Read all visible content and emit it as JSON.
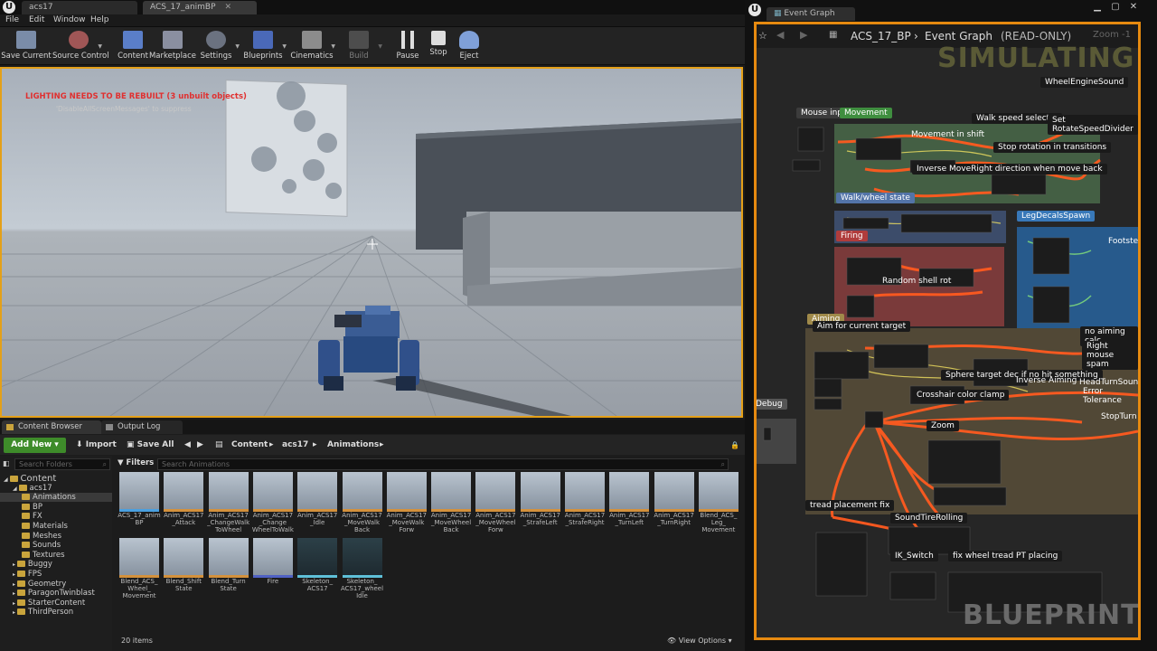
{
  "editor": {
    "tabs": [
      "acs17",
      "ACS_17_animBP"
    ],
    "menu": [
      "File",
      "Edit",
      "Window",
      "Help"
    ],
    "toolbar": {
      "save_current": "Save Current",
      "source_control": "Source Control",
      "content": "Content",
      "marketplace": "Marketplace",
      "settings": "Settings",
      "blueprints": "Blueprints",
      "cinematics": "Cinematics",
      "build": "Build",
      "pause": "Pause",
      "stop": "Stop",
      "eject": "Eject"
    },
    "viewport": {
      "warning": "LIGHTING NEEDS TO BE REBUILT (3 unbuilt objects)",
      "hint": "'DisableAllScreenMessages' to suppress"
    }
  },
  "content_browser": {
    "tabs": [
      "Content Browser",
      "Output Log"
    ],
    "add_new": "Add New",
    "import": "Import",
    "save_all": "Save All",
    "breadcrumb": [
      "Content",
      "acs17",
      "Animations"
    ],
    "search_folders": "Search Folders",
    "filters": "Filters",
    "search_animations": "Search Animations",
    "tree": [
      {
        "label": "Content",
        "level": 0
      },
      {
        "label": "acs17",
        "level": 1
      },
      {
        "label": "Animations",
        "level": 2,
        "selected": true
      },
      {
        "label": "BP",
        "level": 2
      },
      {
        "label": "FX",
        "level": 2
      },
      {
        "label": "Materials",
        "level": 2
      },
      {
        "label": "Meshes",
        "level": 2
      },
      {
        "label": "Sounds",
        "level": 2
      },
      {
        "label": "Textures",
        "level": 2
      },
      {
        "label": "Buggy",
        "level": 1
      },
      {
        "label": "FPS",
        "level": 1
      },
      {
        "label": "Geometry",
        "level": 1
      },
      {
        "label": "ParagonTwinblast",
        "level": 1
      },
      {
        "label": "StarterContent",
        "level": 1
      },
      {
        "label": "ThirdPerson",
        "level": 1
      }
    ],
    "assets": [
      "ACS_17_anim BP",
      "Anim_ACS17 _Attack",
      "Anim_ACS17 _ChangeWalk ToWheel",
      "Anim_ACS17 _Change WheelToWalk",
      "Anim_ACS17 _Idle",
      "Anim_ACS17 _MoveWalk Back",
      "Anim_ACS17 _MoveWalk Forw",
      "Anim_ACS17 _MoveWheel Back",
      "Anim_ACS17 _MoveWheel Forw",
      "Anim_ACS17 _StrafeLeft",
      "Anim_ACS17 _StrafeRight",
      "Anim_ACS17 _TurnLeft",
      "Anim_ACS17 _TurnRight",
      "Blend_ACS_ Leg_ Movement",
      "Blend_ACS_ Wheel_ Movement",
      "Blend_Shift State",
      "Blend_Turn State",
      "Fire",
      "Skeleton_ ACS17",
      "Skeleton_ ACS17_wheel Idle"
    ],
    "item_count": "20 items",
    "view_options": "View Options"
  },
  "blueprint": {
    "tab": "Event Graph",
    "breadcrumb_bp": "ACS_17_BP",
    "breadcrumb_graph": "Event Graph",
    "read_only": "(READ-ONLY)",
    "zoom": "Zoom -1",
    "simulating": "SIMULATING",
    "watermark": "BLUEPRINT",
    "comments": [
      "Mouse input",
      "Movement",
      "WheelEngineSound",
      "Walk speed selector",
      "Set RotateSpeedDivider",
      "Movement in shift",
      "Stop rotation in transitions",
      "Inverse MoveRight direction when move back",
      "Walk/wheel state",
      "LegDecalsSpawn",
      "Footsteps",
      "Firing",
      "Random shell rot",
      "Aiming",
      "Aim for current target",
      "no aiming calc",
      "Right mouse spam",
      "Sphere target dec if no hit something",
      "Inverse Aiming",
      "HeadTurnSound",
      "Error Tolerance",
      "Crosshair color clamp",
      "StopTurn",
      "Debug",
      "Zoom",
      "tread placement fix",
      "SoundTireRolling",
      "IK_Switch",
      "fix wheel tread PT placing"
    ]
  }
}
